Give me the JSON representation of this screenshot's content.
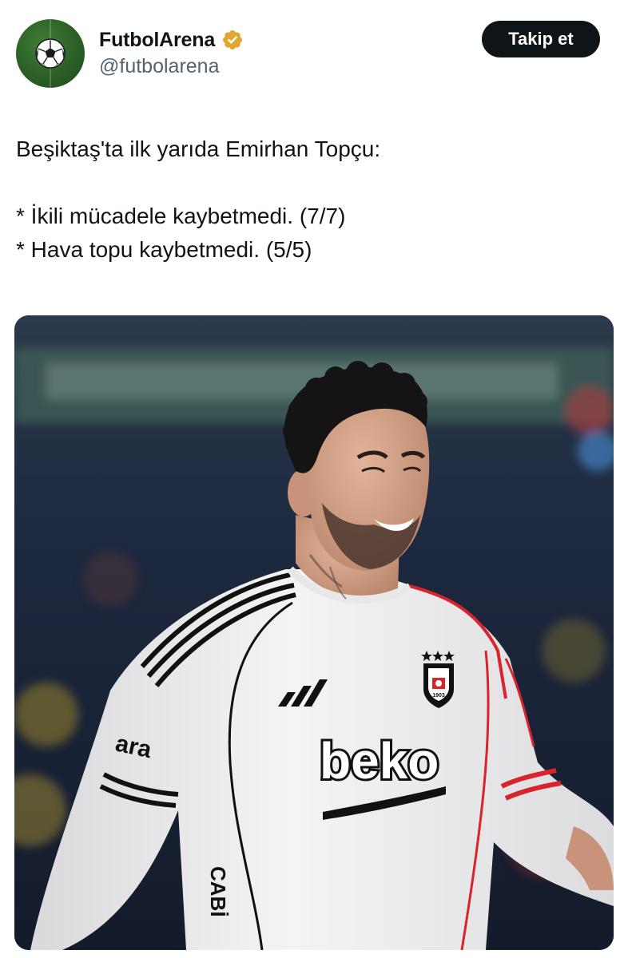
{
  "account": {
    "display_name": "FutbolArena",
    "handle": "@futbolarena",
    "verified_badge_color": "#e2a72e",
    "avatar_icon": "soccer-ball-icon"
  },
  "follow_button": {
    "label": "Takip et"
  },
  "tweet": {
    "lines": [
      "Beşiktaş'ta ilk yarıda Emirhan Topçu:",
      "",
      "* İkili mücadele kaybetmedi. (7/7)",
      "* Hava topu kaybetmedi. (5/5)"
    ]
  },
  "media": {
    "type": "photo",
    "jersey_sponsor": "beko",
    "sleeve_text": "ara",
    "side_text": "CABİ",
    "badge_year": "1903",
    "colors": {
      "jersey": "#f2f2f2",
      "trim_black": "#111111",
      "trim_red": "#d9232d",
      "background": "#1b2333"
    }
  }
}
